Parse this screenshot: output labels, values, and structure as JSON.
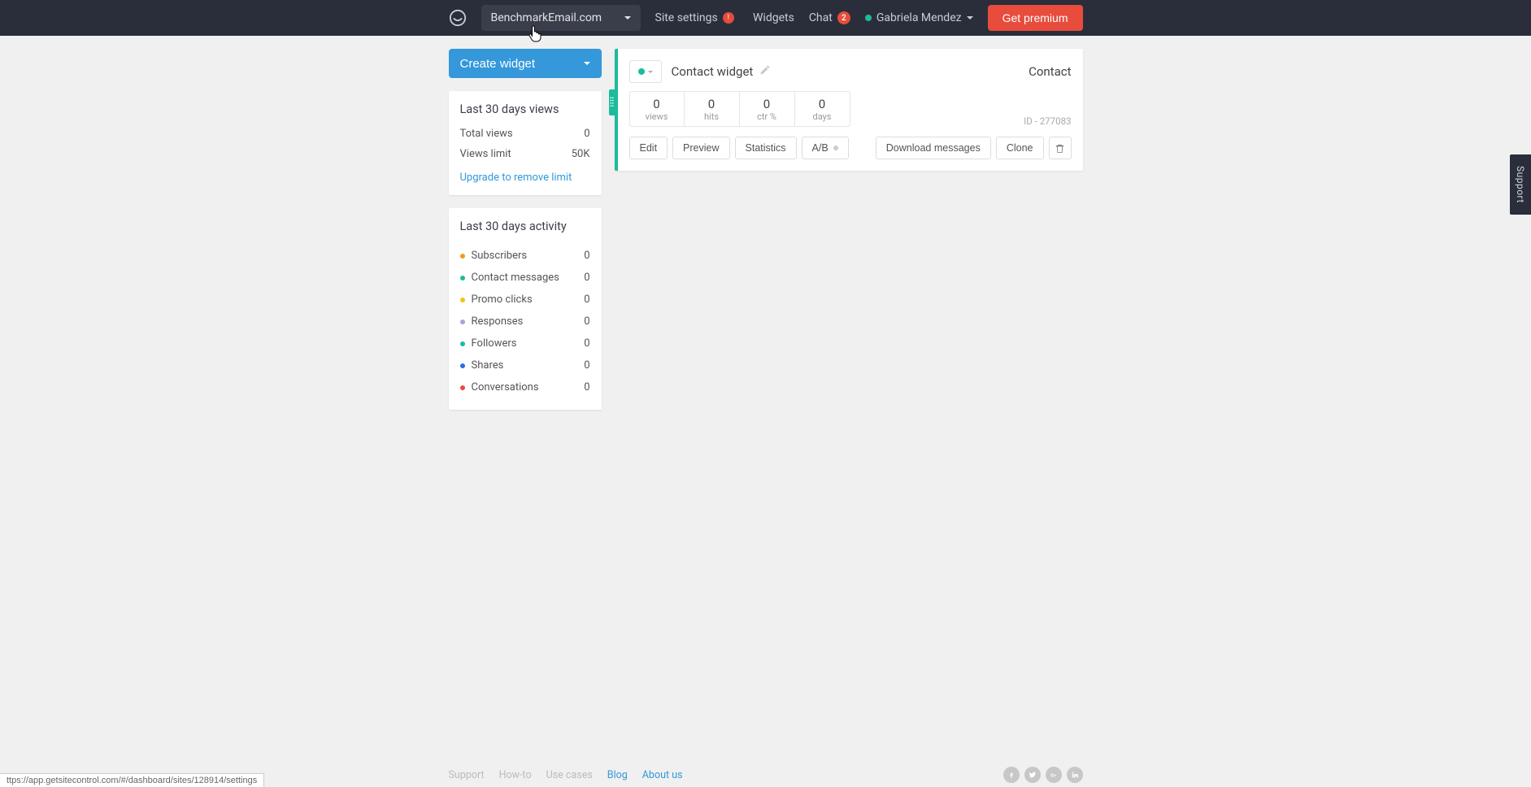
{
  "header": {
    "site_name": "BenchmarkEmail.com",
    "site_settings": "Site settings",
    "site_settings_alert": "!",
    "nav_widgets": "Widgets",
    "nav_chat": "Chat",
    "chat_count": "2",
    "user_name": "Gabriela Mendez",
    "premium_btn": "Get premium"
  },
  "sidebar": {
    "create_widget": "Create widget",
    "views_card": {
      "title": "Last 30 days views",
      "rows": [
        {
          "label": "Total views",
          "value": "0"
        },
        {
          "label": "Views limit",
          "value": "50K"
        }
      ],
      "upgrade_link": "Upgrade to remove limit"
    },
    "activity_card": {
      "title": "Last 30 days activity",
      "items": [
        {
          "label": "Subscribers",
          "value": "0",
          "color": "#f39c12"
        },
        {
          "label": "Contact messages",
          "value": "0",
          "color": "#1abc9c"
        },
        {
          "label": "Promo clicks",
          "value": "0",
          "color": "#f1c40f"
        },
        {
          "label": "Responses",
          "value": "0",
          "color": "#b39ddb"
        },
        {
          "label": "Followers",
          "value": "0",
          "color": "#1abc9c"
        },
        {
          "label": "Shares",
          "value": "0",
          "color": "#2d6cdf"
        },
        {
          "label": "Conversations",
          "value": "0",
          "color": "#e74c3c"
        }
      ]
    }
  },
  "widget": {
    "name": "Contact widget",
    "type": "Contact",
    "id_label": "ID - 277083",
    "stats": [
      {
        "value": "0",
        "label": "views"
      },
      {
        "value": "0",
        "label": "hits"
      },
      {
        "value": "0",
        "label": "ctr %"
      },
      {
        "value": "0",
        "label": "days"
      }
    ],
    "actions": {
      "edit": "Edit",
      "preview": "Preview",
      "statistics": "Statistics",
      "ab": "A/B",
      "download": "Download messages",
      "clone": "Clone"
    }
  },
  "support_tab": "Support",
  "footer": {
    "links": [
      "Support",
      "How-to",
      "Use cases",
      "Blog",
      "About us"
    ]
  },
  "url_hint": "ttps://app.getsitecontrol.com/#/dashboard/sites/128914/settings"
}
